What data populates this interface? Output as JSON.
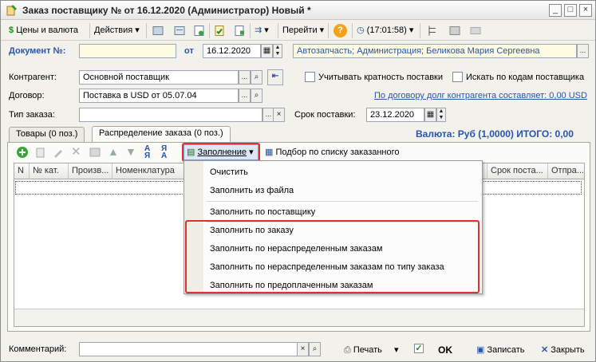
{
  "window": {
    "title": "Заказ поставщику №  от 16.12.2020 (Администратор) Новый *"
  },
  "toolbar": {
    "prices": "Цены и валюта",
    "actions": "Действия",
    "goto": "Перейти",
    "time": "(17:01:58)"
  },
  "header": {
    "doc_label": "Документ №:",
    "doc_number": "",
    "date_label": "от",
    "date_value": "16.12.2020",
    "org_value": "Автозапчасть; Администрация; Беликова Мария Сергеевна",
    "contractor_label": "Контрагент:",
    "contractor_value": "Основной поставщик",
    "contract_label": "Договор:",
    "contract_value": "Поставка в USD от 05.07.04",
    "order_type_label": "Тип заказа:",
    "order_type_value": "",
    "multiplicity_label": "Учитывать кратность поставки",
    "supplier_codes_label": "Искать по кодам поставщика",
    "debt_link": "По договору долг контрагента составляет: 0,00 USD",
    "delivery_label": "Срок поставки:",
    "delivery_value": "23.12.2020"
  },
  "tabs": [
    {
      "label": "Товары (0 поз.)"
    },
    {
      "label": "Распределение заказа (0 поз.)"
    }
  ],
  "currency_total": "Валюта: Руб (1,0000) ИТОГО: 0,00",
  "table_toolbar": {
    "fill": "Заполнение",
    "pick": "Подбор по списку заказанного"
  },
  "columns": [
    "N",
    "№ кат.",
    "Произв...",
    "Номенклатура",
    "Срок поста...",
    "Отпра..."
  ],
  "fill_menu": {
    "items": [
      "Очистить",
      "Заполнить из файла",
      "Заполнить по поставщику",
      "Заполнить по заказу",
      "Заполнить по нераспределенным заказам",
      "Заполнить по нераспределенным заказам по типу заказа",
      "Заполнить по предоплаченным заказам"
    ]
  },
  "footer": {
    "comment_label": "Комментарий:",
    "comment_value": "",
    "print": "Печать",
    "ok": "OK",
    "save": "Записать",
    "close": "Закрыть"
  },
  "colors": {
    "accent_blue": "#2b53a8",
    "highlight_red": "#e03030",
    "window_bg": "#f2f1ec"
  }
}
